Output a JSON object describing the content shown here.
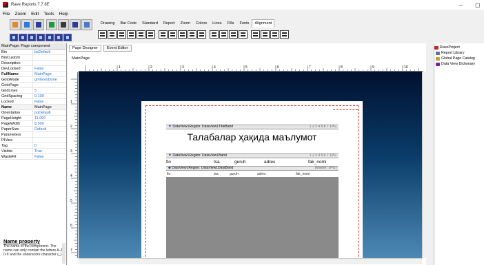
{
  "window": {
    "title": "Rave Reports 7.7.8E",
    "minimize": "–",
    "maximize": "◻"
  },
  "menu": [
    "File",
    "Zoom",
    "Edit",
    "Tools",
    "Help"
  ],
  "toolbar_tabs": {
    "items": [
      "Drawing",
      "Bar Code",
      "Standard",
      "Report",
      "Zoom",
      "Colors",
      "Lines",
      "Fills",
      "Fonts",
      "Alignment"
    ],
    "active": "Alignment"
  },
  "inspector": {
    "header": "MainPage: Page component",
    "properties": [
      {
        "key": "Bin",
        "value": "bsDefault"
      },
      {
        "key": "BinCustom",
        "value": ""
      },
      {
        "key": "Description",
        "value": ""
      },
      {
        "key": "DevLocked",
        "value": "False"
      },
      {
        "key": "FullName",
        "value": "MainPage"
      },
      {
        "key": "GotoMode",
        "value": "gmGotoDone"
      },
      {
        "key": "GotoPage",
        "value": ""
      },
      {
        "key": "GridLines",
        "value": "5"
      },
      {
        "key": "GridSpacing",
        "value": "0.100"
      },
      {
        "key": "Locked",
        "value": "False"
      },
      {
        "key": "Name",
        "value": "MainPage"
      },
      {
        "key": "Orientation",
        "value": "poDefault"
      },
      {
        "key": "PageHeight",
        "value": "11.000"
      },
      {
        "key": "PageWidth",
        "value": "8.500"
      },
      {
        "key": "PaperSize",
        "value": "Default"
      },
      {
        "key": "Parameters",
        "value": ""
      },
      {
        "key": "PIVars",
        "value": ""
      },
      {
        "key": "Tag",
        "value": "0"
      },
      {
        "key": "Visible",
        "value": "True"
      },
      {
        "key": "WasteFit",
        "value": "False"
      }
    ],
    "help_title": "Name property",
    "help_text": "The name of the component. The name can only contain the letters A-Z, 0-9 and the underscore character (_)."
  },
  "designer": {
    "tabs": [
      "Page Designer",
      "Event Editor"
    ],
    "active_tab": "Page Designer",
    "page_label": "MainPage",
    "ruler_labels": [
      "1",
      "2",
      "3",
      "4",
      "5",
      "6",
      "7",
      "8",
      "9",
      "10"
    ],
    "vruler_labels": [
      "1",
      "2",
      "3",
      "4",
      "5",
      "6",
      "7"
    ],
    "bands": [
      {
        "label": "DataView1Region: DataView1TitleBand",
        "right": "1 2 3 4 5 6 7  1PG"
      },
      {
        "label": "DataView1Region: DataView1Band",
        "right": "1 2 3 4 5 6 7  1PG"
      },
      {
        "label": "DataView1Region: DataView1DataBand",
        "right": "(Master: 1PG)"
      }
    ],
    "title_text": "Талабалар ҳақида маълумот",
    "columns": [
      "fio",
      "tsa",
      "guruh",
      "adres",
      "fak_nomi"
    ],
    "data_fields": [
      "fio",
      "tsa",
      "guruh",
      "adres",
      "fak_nomi"
    ]
  },
  "tree": {
    "items": [
      {
        "label": "RaveProject",
        "icon_color": "#c62828"
      },
      {
        "label": "Report Library",
        "icon_color": "#6b6b9b"
      },
      {
        "label": "Global Page Catalog",
        "icon_color": "#c9a227"
      },
      {
        "label": "Data View Dictionary",
        "icon_color": "#7b1fa2"
      }
    ]
  },
  "colors": {
    "accent_blue": "#1f6bd8",
    "canvas_top": "#001030",
    "canvas_bottom": "#4d89b5",
    "band_arrow": "#1b3ca8"
  }
}
